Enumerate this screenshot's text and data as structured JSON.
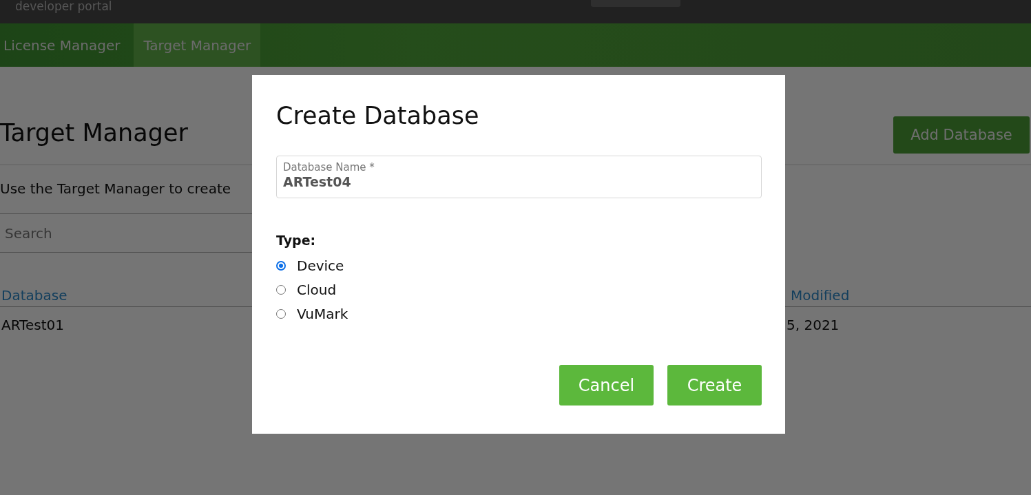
{
  "header": {
    "brand": "developer portal"
  },
  "nav": {
    "tabs": [
      {
        "label": "License Manager",
        "selected": false
      },
      {
        "label": "Target Manager",
        "selected": true
      }
    ]
  },
  "main": {
    "title": "Target Manager",
    "add_button": "Add Database",
    "description": "Use the Target Manager to create",
    "search": {
      "placeholder": "Search"
    },
    "table": {
      "columns": [
        "Database",
        "Modified"
      ],
      "rows": [
        [
          "ARTest01",
          "5, 2021"
        ]
      ]
    }
  },
  "dialog": {
    "title": "Create Database",
    "field": {
      "label": "Database Name *",
      "value": "ARTest04"
    },
    "type_label": "Type:",
    "options": [
      {
        "label": "Device",
        "selected": true
      },
      {
        "label": "Cloud",
        "selected": false
      },
      {
        "label": "VuMark",
        "selected": false
      }
    ],
    "buttons": [
      {
        "label": "Cancel"
      },
      {
        "label": "Create"
      }
    ]
  }
}
